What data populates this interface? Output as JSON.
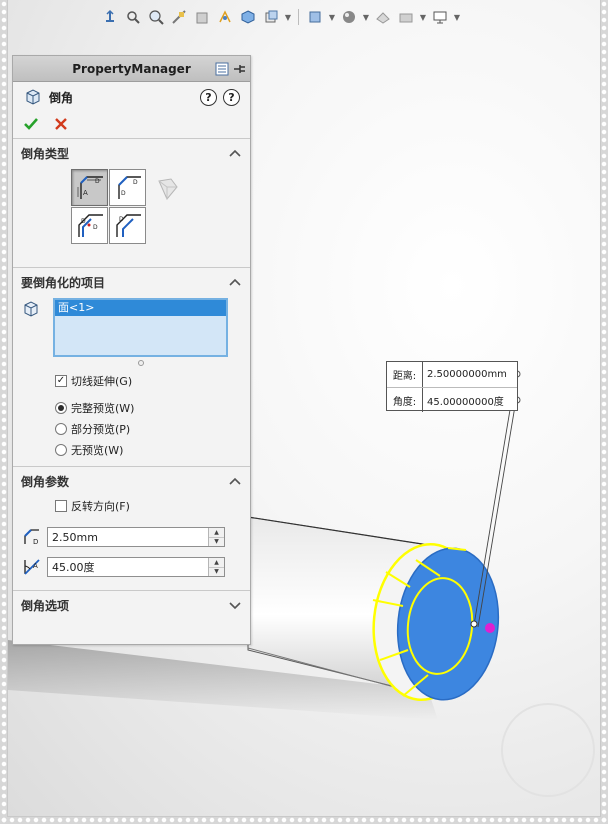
{
  "panel": {
    "title": "PropertyManager",
    "feature_name": "倒角",
    "help_icon": "help-question-icon",
    "ok_icon": "checkmark-icon",
    "cancel_icon": "cancel-x-icon"
  },
  "chamfer_type": {
    "title": "倒角类型",
    "options": [
      "angle-distance",
      "distance-distance",
      "vertex",
      "offset-face",
      "face-face"
    ],
    "selected": "angle-distance"
  },
  "items_to_chamfer": {
    "title": "要倒角化的项目",
    "selection_list": [
      "面<1>"
    ],
    "tangent_propagation": {
      "label": "切线延伸(G)",
      "checked": true
    },
    "preview_options": [
      {
        "label": "完整预览(W)",
        "selected": true
      },
      {
        "label": "部分预览(P)",
        "selected": false
      },
      {
        "label": "无预览(W)",
        "selected": false
      }
    ]
  },
  "chamfer_params": {
    "title": "倒角参数",
    "flip_direction": {
      "label": "反转方向(F)",
      "checked": false
    },
    "distance": "2.50mm",
    "angle": "45.00度"
  },
  "chamfer_options": {
    "title": "倒角选项"
  },
  "callout": {
    "distance_label": "距离:",
    "distance_value": "2.50000000mm",
    "angle_label": "角度:",
    "angle_value": "45.00000000度"
  },
  "colors": {
    "selected_face": "#3d86e0",
    "edge_highlight": "#ffff00",
    "selection_box": "#d3e6f7",
    "selection_item": "#2f8ad8",
    "marker": "#e020d0"
  }
}
